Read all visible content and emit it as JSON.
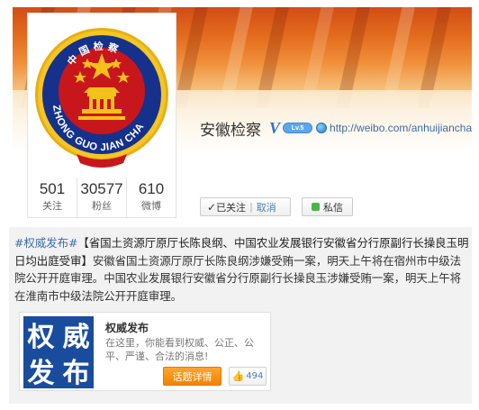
{
  "profile": {
    "name": "安徽检察",
    "verified_mark": "V",
    "level_badge": "Lv.5",
    "url": "http://weibo.com/anhuijiancha",
    "emblem_top_text": "中国检察",
    "emblem_ring_text": "ZHONG GUO JIAN CHA",
    "stats": [
      {
        "value": "501",
        "label": "关注"
      },
      {
        "value": "30577",
        "label": "粉丝"
      },
      {
        "value": "610",
        "label": "微博"
      }
    ]
  },
  "actions": {
    "followed_label": "已关注",
    "cancel_label": "取消",
    "message_label": "私信"
  },
  "post": {
    "hashtag": "#权威发布#",
    "headline": "【省国土资源厅原厅长陈良纲、中国农业发展银行安徽省分行原副行长操良玉明日均出庭受审】",
    "body": "安徽省国土资源厅原厅长陈良纲涉嫌受贿一案，明天上午将在宿州市中级法院公开开庭审理。中国农业发展银行安徽省分行原副行长操良玉涉嫌受贿一案，明天上午将在淮南市中级法院公开开庭审理。"
  },
  "topic_card": {
    "image_chars": [
      "权",
      "威",
      "发",
      "布"
    ],
    "title": "权威发布",
    "description": "在这里，你能看到权威、公正、公平、严谨、合法的消息!",
    "detail_button": "话题详情",
    "like_count": "494"
  },
  "colors": {
    "link": "#3c6ea8",
    "orange_button": "#f08300",
    "emblem_red": "#c8161d",
    "emblem_gold": "#f3c11a",
    "topic_blue": "#1a4c9e"
  }
}
